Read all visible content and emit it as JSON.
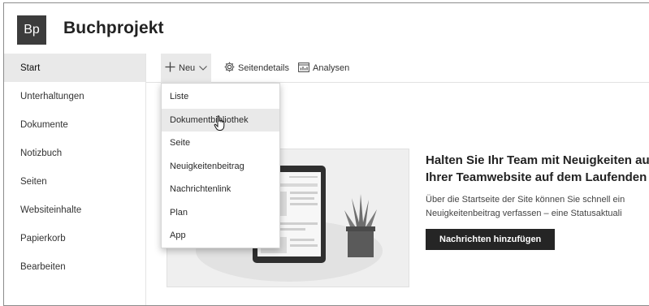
{
  "header": {
    "logo_text": "Bp",
    "site_title": "Buchprojekt"
  },
  "leftnav": {
    "items": [
      {
        "label": "Start",
        "active": true
      },
      {
        "label": "Unterhaltungen"
      },
      {
        "label": "Dokumente"
      },
      {
        "label": "Notizbuch"
      },
      {
        "label": "Seiten"
      },
      {
        "label": "Websiteinhalte"
      },
      {
        "label": "Papierkorb"
      },
      {
        "label": "Bearbeiten"
      }
    ]
  },
  "commandbar": {
    "new_label": "Neu",
    "new_icon": "plus-icon",
    "page_details_label": "Seitendetails",
    "page_details_icon": "gear-icon",
    "analytics_label": "Analysen",
    "analytics_icon": "chart-icon"
  },
  "new_menu": {
    "items": [
      "Liste",
      "Dokumentbibliothek",
      "Seite",
      "Neuigkeitenbeitrag",
      "Nachrichtenlink",
      "Plan",
      "App"
    ],
    "hovered": "Dokumentbibliothek"
  },
  "hero": {
    "title_line1": "Halten Sie Ihr Team mit Neuigkeiten au",
    "title_line2": "Ihrer Teamwebsite auf dem Laufenden",
    "desc_line1": "Über die Startseite der Site können Sie schnell ein",
    "desc_line2": "Neuigkeitenbeitrag verfassen – eine Statusaktuali",
    "button_label": "Nachrichten hinzufügen"
  },
  "colors": {
    "logo_bg": "#3c3c3c",
    "button_bg": "#252525",
    "active_bg": "#e9e9e9"
  }
}
